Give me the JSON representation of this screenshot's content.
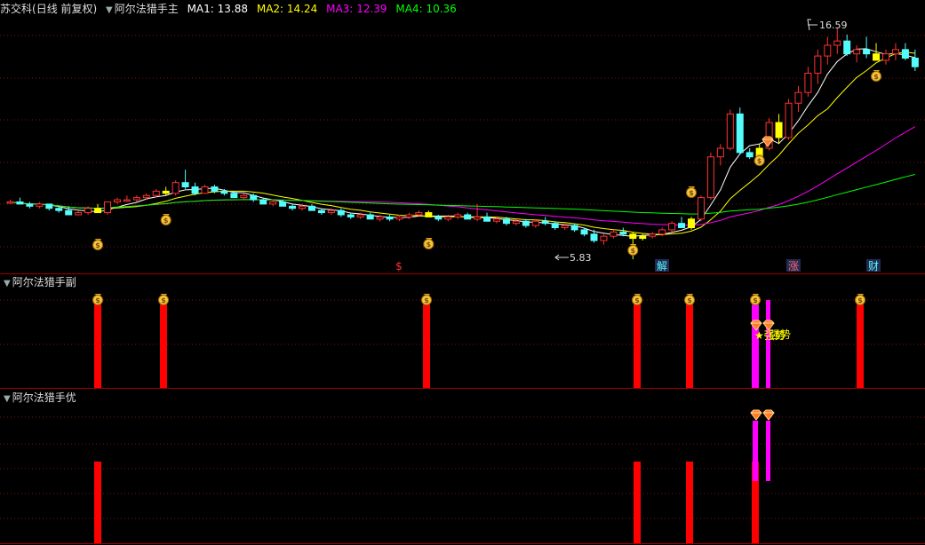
{
  "main": {
    "stock_name": "苏交科",
    "period": "(日线 前复权)",
    "indicator": "阿尔法猎手主",
    "ma": [
      {
        "label": "MA1:",
        "value": "13.88",
        "color": "#ffffff"
      },
      {
        "label": "MA2:",
        "value": "14.24",
        "color": "#ffff00"
      },
      {
        "label": "MA3:",
        "value": "12.39",
        "color": "#ff00ff"
      },
      {
        "label": "MA4:",
        "value": "10.36",
        "color": "#00ff00"
      }
    ],
    "high_label": "16.59",
    "low_label": "5.83",
    "event_markers": [
      "$",
      "解",
      "涨",
      "财"
    ]
  },
  "sub1": {
    "title": "阿尔法猎手副",
    "text_overlay": "★强势",
    "text_overlay2": "强势"
  },
  "sub2": {
    "title": "阿尔法猎手优"
  },
  "colors": {
    "up": "#ff3232",
    "down": "#54fcfc",
    "signal": "#ffff00",
    "bar_red": "#ff0000",
    "bar_magenta": "#ff00ff"
  },
  "chart_data": {
    "type": "candlestick",
    "y_axis_range": [
      5.5,
      17.0
    ],
    "high_marker": 16.59,
    "low_marker": 5.83,
    "series": [
      {
        "name": "MA1",
        "color": "#ffffff"
      },
      {
        "name": "MA2",
        "color": "#ffff00"
      },
      {
        "name": "MA3",
        "color": "#ff00ff"
      },
      {
        "name": "MA4",
        "color": "#00ff00"
      }
    ],
    "candles": [
      [
        8.5,
        8.6,
        8.4,
        8.5
      ],
      [
        8.5,
        8.7,
        8.4,
        8.4
      ],
      [
        8.4,
        8.5,
        8.2,
        8.3
      ],
      [
        8.3,
        8.5,
        8.2,
        8.4
      ],
      [
        8.4,
        8.4,
        8.1,
        8.2
      ],
      [
        8.2,
        8.3,
        8.0,
        8.1
      ],
      [
        8.1,
        8.3,
        7.9,
        7.9
      ],
      [
        7.9,
        8.1,
        7.9,
        8.0
      ],
      [
        8.0,
        8.3,
        7.9,
        8.2
      ],
      [
        8.2,
        8.4,
        8.0,
        8.0
      ],
      [
        8.0,
        8.4,
        7.9,
        8.5
      ],
      [
        8.5,
        8.7,
        8.4,
        8.6
      ],
      [
        8.6,
        8.8,
        8.5,
        8.6
      ],
      [
        8.6,
        8.8,
        8.5,
        8.7
      ],
      [
        8.7,
        8.9,
        8.6,
        8.8
      ],
      [
        8.8,
        9.1,
        8.7,
        9.0
      ],
      [
        9.0,
        9.2,
        8.8,
        8.9
      ],
      [
        8.9,
        9.5,
        8.8,
        9.4
      ],
      [
        9.4,
        10.0,
        9.1,
        9.2
      ],
      [
        9.2,
        9.4,
        8.8,
        8.9
      ],
      [
        8.9,
        9.3,
        8.9,
        9.2
      ],
      [
        9.2,
        9.3,
        8.9,
        9.0
      ],
      [
        9.0,
        9.1,
        8.8,
        8.9
      ],
      [
        8.9,
        9.0,
        8.7,
        8.7
      ],
      [
        8.7,
        8.9,
        8.6,
        8.8
      ],
      [
        8.8,
        8.9,
        8.5,
        8.6
      ],
      [
        8.6,
        8.7,
        8.4,
        8.4
      ],
      [
        8.4,
        8.6,
        8.3,
        8.5
      ],
      [
        8.5,
        8.6,
        8.3,
        8.3
      ],
      [
        8.3,
        8.4,
        8.1,
        8.2
      ],
      [
        8.2,
        8.4,
        8.1,
        8.3
      ],
      [
        8.3,
        8.4,
        8.1,
        8.1
      ],
      [
        8.1,
        8.2,
        7.9,
        8.0
      ],
      [
        8.0,
        8.2,
        7.9,
        8.1
      ],
      [
        8.1,
        8.2,
        7.8,
        7.9
      ],
      [
        7.9,
        8.0,
        7.7,
        7.8
      ],
      [
        7.8,
        8.0,
        7.7,
        7.9
      ],
      [
        7.9,
        8.0,
        7.7,
        7.7
      ],
      [
        7.7,
        7.9,
        7.6,
        7.8
      ],
      [
        7.8,
        7.9,
        7.6,
        7.7
      ],
      [
        7.7,
        7.9,
        7.6,
        7.8
      ],
      [
        7.8,
        8.0,
        7.7,
        7.9
      ],
      [
        7.9,
        8.1,
        7.8,
        8.0
      ],
      [
        8.0,
        8.1,
        7.8,
        7.8
      ],
      [
        7.8,
        7.9,
        7.6,
        7.7
      ],
      [
        7.7,
        7.9,
        7.6,
        7.8
      ],
      [
        7.8,
        8.0,
        7.7,
        7.9
      ],
      [
        7.9,
        8.0,
        7.7,
        7.7
      ],
      [
        7.7,
        8.4,
        7.6,
        7.8
      ],
      [
        7.8,
        8.0,
        7.6,
        7.6
      ],
      [
        7.6,
        7.8,
        7.5,
        7.7
      ],
      [
        7.7,
        7.8,
        7.4,
        7.5
      ],
      [
        7.5,
        7.7,
        7.4,
        7.6
      ],
      [
        7.6,
        7.7,
        7.3,
        7.4
      ],
      [
        7.4,
        7.7,
        7.3,
        7.6
      ],
      [
        7.6,
        7.8,
        7.4,
        7.5
      ],
      [
        7.5,
        7.6,
        7.2,
        7.3
      ],
      [
        7.3,
        7.5,
        7.2,
        7.4
      ],
      [
        7.4,
        7.5,
        7.1,
        7.2
      ],
      [
        7.2,
        7.3,
        6.9,
        7.0
      ],
      [
        7.0,
        7.2,
        6.6,
        6.7
      ],
      [
        6.7,
        7.0,
        6.5,
        6.9
      ],
      [
        6.9,
        7.2,
        6.8,
        7.1
      ],
      [
        7.1,
        7.3,
        6.9,
        7.0
      ],
      [
        7.0,
        7.1,
        5.83,
        6.8
      ],
      [
        6.8,
        7.0,
        6.7,
        6.9
      ],
      [
        6.9,
        7.1,
        6.8,
        7.0
      ],
      [
        7.0,
        7.3,
        6.9,
        7.2
      ],
      [
        7.2,
        7.6,
        7.1,
        7.5
      ],
      [
        7.5,
        7.8,
        7.3,
        7.3
      ],
      [
        7.3,
        7.8,
        7.2,
        7.7
      ],
      [
        7.7,
        8.8,
        7.6,
        8.7
      ],
      [
        8.7,
        10.8,
        8.6,
        10.6
      ],
      [
        10.6,
        11.2,
        10.2,
        11.0
      ],
      [
        11.0,
        12.8,
        10.9,
        12.6
      ],
      [
        12.6,
        12.9,
        10.7,
        10.8
      ],
      [
        10.8,
        11.0,
        10.5,
        10.6
      ],
      [
        10.6,
        11.2,
        10.4,
        11.0
      ],
      [
        11.0,
        12.4,
        10.9,
        12.2
      ],
      [
        12.2,
        12.6,
        11.2,
        11.5
      ],
      [
        11.5,
        13.3,
        11.4,
        13.1
      ],
      [
        13.1,
        13.9,
        12.7,
        13.6
      ],
      [
        13.6,
        14.8,
        13.4,
        14.5
      ],
      [
        14.5,
        15.6,
        14.0,
        15.3
      ],
      [
        15.3,
        16.2,
        14.9,
        15.8
      ],
      [
        15.8,
        16.59,
        15.4,
        16.0
      ],
      [
        16.0,
        16.3,
        15.3,
        15.4
      ],
      [
        15.4,
        15.8,
        15.0,
        15.6
      ],
      [
        15.6,
        16.2,
        15.2,
        15.4
      ],
      [
        15.4,
        15.9,
        15.1,
        15.1
      ],
      [
        15.1,
        15.6,
        14.9,
        15.4
      ],
      [
        15.4,
        15.9,
        15.1,
        15.6
      ],
      [
        15.6,
        15.9,
        15.1,
        15.2
      ],
      [
        15.2,
        15.6,
        14.6,
        14.8
      ]
    ]
  }
}
